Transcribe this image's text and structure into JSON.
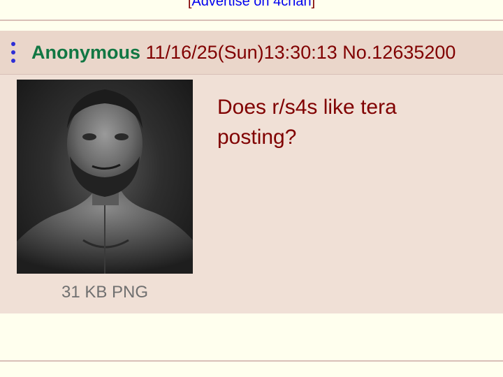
{
  "ad": {
    "bracket_open": "[",
    "label": "Advertise on 4chan",
    "bracket_close": "]"
  },
  "post": {
    "name": "Anonymous",
    "datetime": "11/16/25(Sun)13:30:13",
    "number": "No.12635200",
    "comment": "Does r/s4s like tera posting?",
    "file_info": "31 KB PNG"
  },
  "icons": {
    "menu": "vertical-dots-menu-icon"
  },
  "colors": {
    "background": "#FFFFEE",
    "post_background": "#F0E0D6",
    "name": "#117743",
    "text": "#800000",
    "link": "#0000EE"
  }
}
